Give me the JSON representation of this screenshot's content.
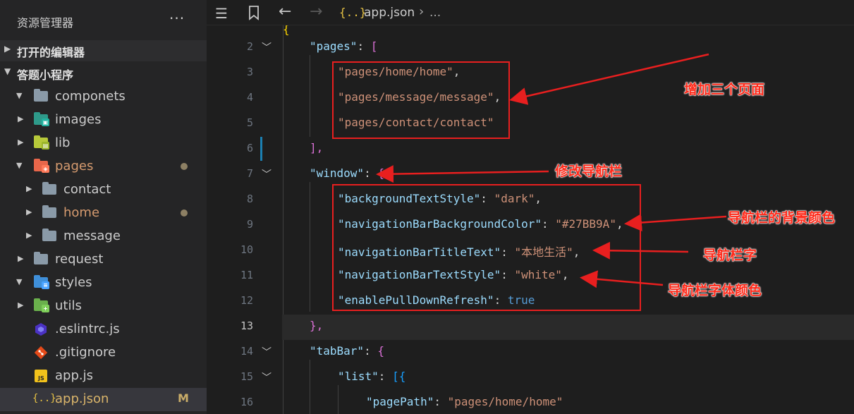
{
  "sidebar": {
    "title": "资源管理器",
    "more": "···",
    "sections": {
      "open_editors": "打开的编辑器",
      "project": "答题小程序"
    },
    "tree": [
      {
        "name": "componets",
        "icon": "folder-icon"
      },
      {
        "name": "images",
        "icon": "images-folder-icon"
      },
      {
        "name": "lib",
        "icon": "lib-folder-icon"
      },
      {
        "name": "pages",
        "icon": "pages-folder-icon"
      },
      {
        "name": "contact",
        "icon": "folder-icon"
      },
      {
        "name": "home",
        "icon": "folder-icon"
      },
      {
        "name": "message",
        "icon": "folder-icon"
      },
      {
        "name": "request",
        "icon": "folder-icon"
      },
      {
        "name": "styles",
        "icon": "styles-folder-icon"
      },
      {
        "name": "utils",
        "icon": "utils-folder-icon"
      },
      {
        "name": ".eslintrc.js",
        "icon": "eslint-icon"
      },
      {
        "name": ".gitignore",
        "icon": "git-icon"
      },
      {
        "name": "app.js",
        "icon": "javascript-icon"
      },
      {
        "name": "app.json",
        "icon": "json-icon",
        "badge": "M"
      }
    ]
  },
  "editor": {
    "breadcrumb": {
      "file_icon": "{..}",
      "file": "app.json",
      "separator": "›",
      "ellipsis": "..."
    },
    "current_line": "13",
    "lines": [
      {
        "n": "2"
      },
      {
        "n": "3"
      },
      {
        "n": "4"
      },
      {
        "n": "5"
      },
      {
        "n": "6"
      },
      {
        "n": "7"
      },
      {
        "n": "8"
      },
      {
        "n": "9"
      },
      {
        "n": "10"
      },
      {
        "n": "11"
      },
      {
        "n": "12"
      },
      {
        "n": "13"
      },
      {
        "n": "14"
      },
      {
        "n": "15"
      },
      {
        "n": "16"
      }
    ],
    "code": {
      "pages_key": "\"pages\"",
      "colon": ": ",
      "lbracket": "[",
      "page1": "\"pages/home/home\"",
      "page2": "\"pages/message/message\"",
      "page3": "\"pages/contact/contact\"",
      "comma": ",",
      "rbracket_comma": "],",
      "window_key": "\"window\"",
      "lbrace": "{",
      "bts_key": "\"backgroundTextStyle\"",
      "bts_val": "\"dark\"",
      "nbbc_key": "\"navigationBarBackgroundColor\"",
      "nbbc_val": "\"#27BB9A\"",
      "nbtt_key": "\"navigationBarTitleText\"",
      "nbtt_val_q": "\"",
      "nbtt_val": "本地生活",
      "nbts_key": "\"navigationBarTextStyle\"",
      "nbts_val": "\"white\"",
      "epdr_key": "\"enablePullDownRefresh\"",
      "epdr_val": "true",
      "rbrace_comma": "},",
      "tabbar_key": "\"tabBar\"",
      "list_key": "\"list\"",
      "list_open": "[{",
      "pagepath_key": "\"pagePath\"",
      "pagepath_val": "\"pages/home/home\""
    }
  },
  "annotations": {
    "add_pages": "增加三个页面",
    "modify_nav": "修改导航栏",
    "nav_bg_color": "导航栏的背景颜色",
    "nav_text": "导航栏字",
    "nav_font_color": "导航栏字体颜色"
  },
  "colors": {
    "annotation": "#e81f1f",
    "accent": "#1b80b2"
  }
}
